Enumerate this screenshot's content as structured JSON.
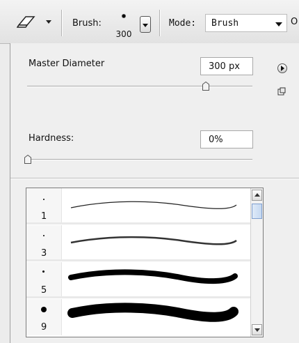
{
  "toolbar": {
    "tool_icon": "eraser-icon",
    "brush_label": "Brush:",
    "brush_size": "300",
    "mode_label": "Mode:",
    "mode_value": "Brush",
    "cut_letter": "O"
  },
  "panel": {
    "master_diameter_label": "Master Diameter",
    "master_diameter_value": "300 px",
    "master_diameter_slider_fraction": 0.76,
    "hardness_label": "Hardness:",
    "hardness_value": "0%",
    "hardness_slider_fraction": 0.0,
    "flyout_icon": "flyout-menu-icon",
    "new_preset_icon": "new-preset-icon"
  },
  "brush_presets": [
    {
      "size": "1"
    },
    {
      "size": "3"
    },
    {
      "size": "5"
    },
    {
      "size": "9"
    }
  ],
  "scrollbar": {
    "up_icon": "scroll-up-icon",
    "down_icon": "scroll-down-icon"
  }
}
